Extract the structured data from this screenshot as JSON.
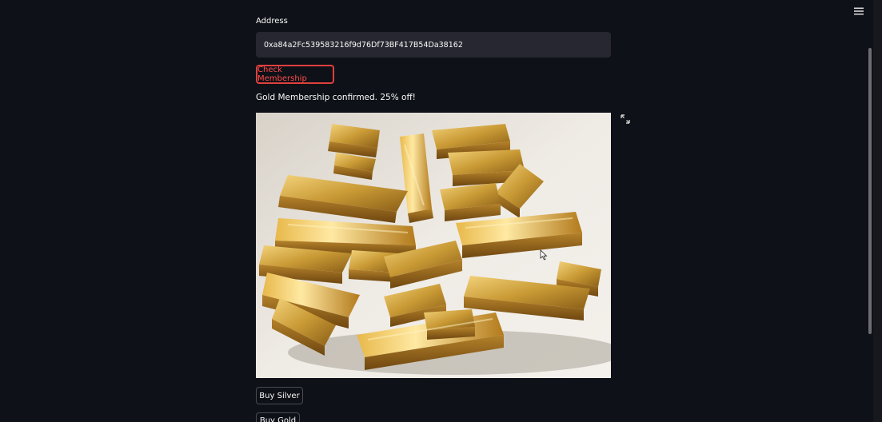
{
  "form": {
    "address_label": "Address",
    "address_value": "0xa84a2Fc539583216f9d76Df73BF417B54Da38162",
    "check_button": "Check Membership",
    "status_message": "Gold Membership confirmed. 25% off!"
  },
  "image": {
    "alt": "gold bars"
  },
  "actions": {
    "buy_silver": "Buy Silver",
    "buy_gold": "Buy Gold"
  },
  "icons": {
    "menu": "hamburger-menu-icon",
    "fullscreen": "expand-fullscreen-icon"
  },
  "colors": {
    "background": "#0e1117",
    "input_bg": "#262730",
    "accent_red": "#ff4b4b",
    "gold": "#c9962e"
  }
}
